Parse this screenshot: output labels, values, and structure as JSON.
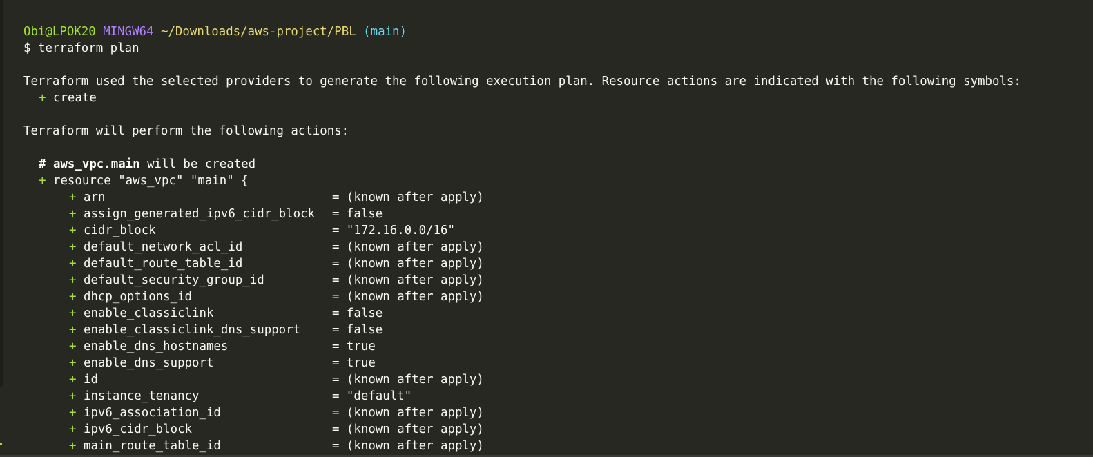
{
  "prompt": {
    "user_host": "Obi@LPOK20",
    "shell": "MINGW64",
    "path": "~/Downloads/aws-project/PBL",
    "branch": "(main)",
    "symbol": "$",
    "command": "terraform plan"
  },
  "intro": {
    "line1": "Terraform used the selected providers to generate the following execution plan. Resource actions are indicated with the following symbols:",
    "create_symbol": "+",
    "create_label": "create",
    "line2": "Terraform will perform the following actions:"
  },
  "resource": {
    "comment_hash": "#",
    "address": "aws_vpc.main",
    "comment_rest": " will be created",
    "plus": "+",
    "declaration": "resource \"aws_vpc\" \"main\" {"
  },
  "attributes": [
    {
      "sign": "+",
      "name": "arn",
      "value": "= (known after apply)"
    },
    {
      "sign": "+",
      "name": "assign_generated_ipv6_cidr_block",
      "value": "= false"
    },
    {
      "sign": "+",
      "name": "cidr_block",
      "value": "= \"172.16.0.0/16\""
    },
    {
      "sign": "+",
      "name": "default_network_acl_id",
      "value": "= (known after apply)"
    },
    {
      "sign": "+",
      "name": "default_route_table_id",
      "value": "= (known after apply)"
    },
    {
      "sign": "+",
      "name": "default_security_group_id",
      "value": "= (known after apply)"
    },
    {
      "sign": "+",
      "name": "dhcp_options_id",
      "value": "= (known after apply)"
    },
    {
      "sign": "+",
      "name": "enable_classiclink",
      "value": "= false"
    },
    {
      "sign": "+",
      "name": "enable_classiclink_dns_support",
      "value": "= false"
    },
    {
      "sign": "+",
      "name": "enable_dns_hostnames",
      "value": "= true"
    },
    {
      "sign": "+",
      "name": "enable_dns_support",
      "value": "= true"
    },
    {
      "sign": "+",
      "name": "id",
      "value": "= (known after apply)"
    },
    {
      "sign": "+",
      "name": "instance_tenancy",
      "value": "= \"default\""
    },
    {
      "sign": "+",
      "name": "ipv6_association_id",
      "value": "= (known after apply)"
    },
    {
      "sign": "+",
      "name": "ipv6_cidr_block",
      "value": "= (known after apply)"
    },
    {
      "sign": "+",
      "name": "main_route_table_id",
      "value": "= (known after apply)"
    }
  ]
}
